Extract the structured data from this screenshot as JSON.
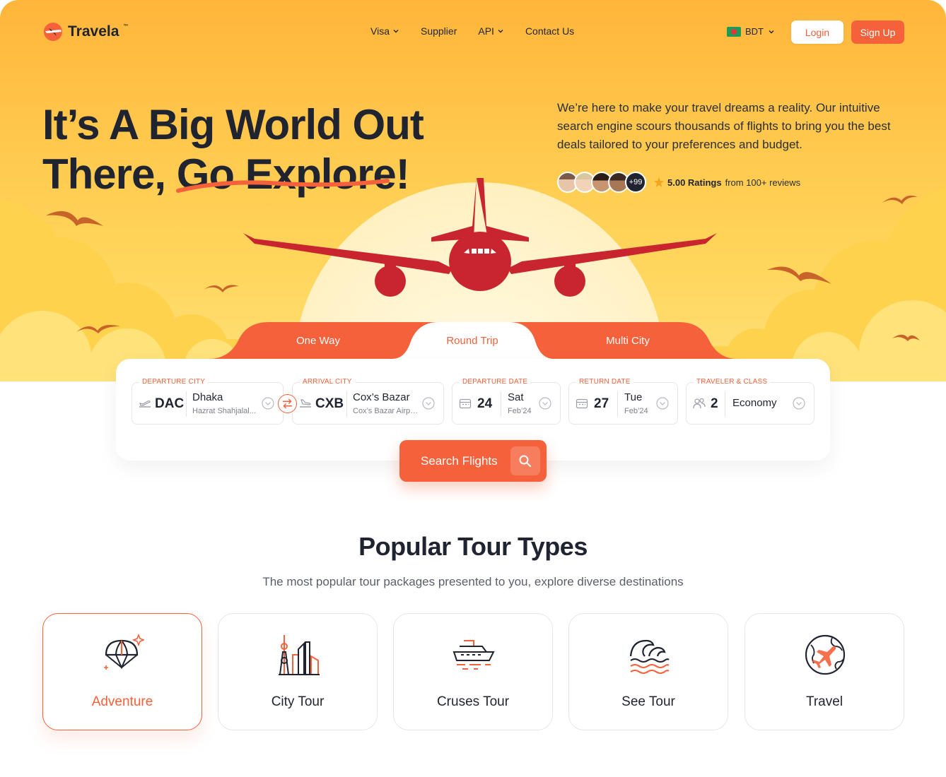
{
  "brand": {
    "name": "Travela",
    "tm": "™"
  },
  "nav": {
    "items": [
      {
        "label": "Visa",
        "dropdown": true
      },
      {
        "label": "Supplier",
        "dropdown": false
      },
      {
        "label": "API",
        "dropdown": true
      },
      {
        "label": "Contact Us",
        "dropdown": false
      }
    ],
    "currency": "BDT",
    "login_label": "Login",
    "signup_label": "Sign Up"
  },
  "hero": {
    "headline_line1": "It’s A Big World Out",
    "headline_line2": "There, Go Explore!",
    "intro": "We’re here to make your travel dreams a reality. Our intuitive search engine scours thousands of flights to bring you the best deals tailored to your preferences and budget.",
    "avatar_more": "+99",
    "rating_value": "5.00 Ratings",
    "rating_sub": "from 100+ reviews"
  },
  "tabs": [
    {
      "label": "One Way",
      "active": false
    },
    {
      "label": "Round Trip",
      "active": true
    },
    {
      "label": "Multi City",
      "active": false
    }
  ],
  "search": {
    "departure": {
      "label": "DEPARTURE CITY",
      "code": "DAC",
      "city": "Dhaka",
      "airport": "Hazrat Shahjalal..."
    },
    "arrival": {
      "label": "ARRIVAL CITY",
      "code": "CXB",
      "city": "Cox’s Bazar",
      "airport": "Cox’s Bazar Airpo..."
    },
    "departure_date": {
      "label": "DEPARTURE DATE",
      "day": "24",
      "weekday": "Sat",
      "month": "Feb’24"
    },
    "return_date": {
      "label": "RETURN DATE",
      "day": "27",
      "weekday": "Tue",
      "month": "Feb’24"
    },
    "traveler": {
      "label": "TRAVELER & CLASS",
      "count": "2",
      "class": "Economy"
    },
    "button_label": "Search Flights"
  },
  "tours_section": {
    "title": "Popular Tour Types",
    "subtitle": "The most popular tour packages presented to you, explore diverse destinations",
    "items": [
      {
        "label": "Adventure",
        "icon": "parachute-icon",
        "active": true
      },
      {
        "label": "City Tour",
        "icon": "city-icon",
        "active": false
      },
      {
        "label": "Cruses Tour",
        "icon": "cruise-ship-icon",
        "active": false
      },
      {
        "label": "See Tour",
        "icon": "waves-icon",
        "active": false
      },
      {
        "label": "Travel",
        "icon": "globe-plane-icon",
        "active": false
      }
    ]
  },
  "colors": {
    "accent": "#f5613a",
    "plane": "#c8252f",
    "hero_top": "#ffb53a",
    "hero_bottom": "#ffe07a",
    "text": "#1f2430"
  }
}
